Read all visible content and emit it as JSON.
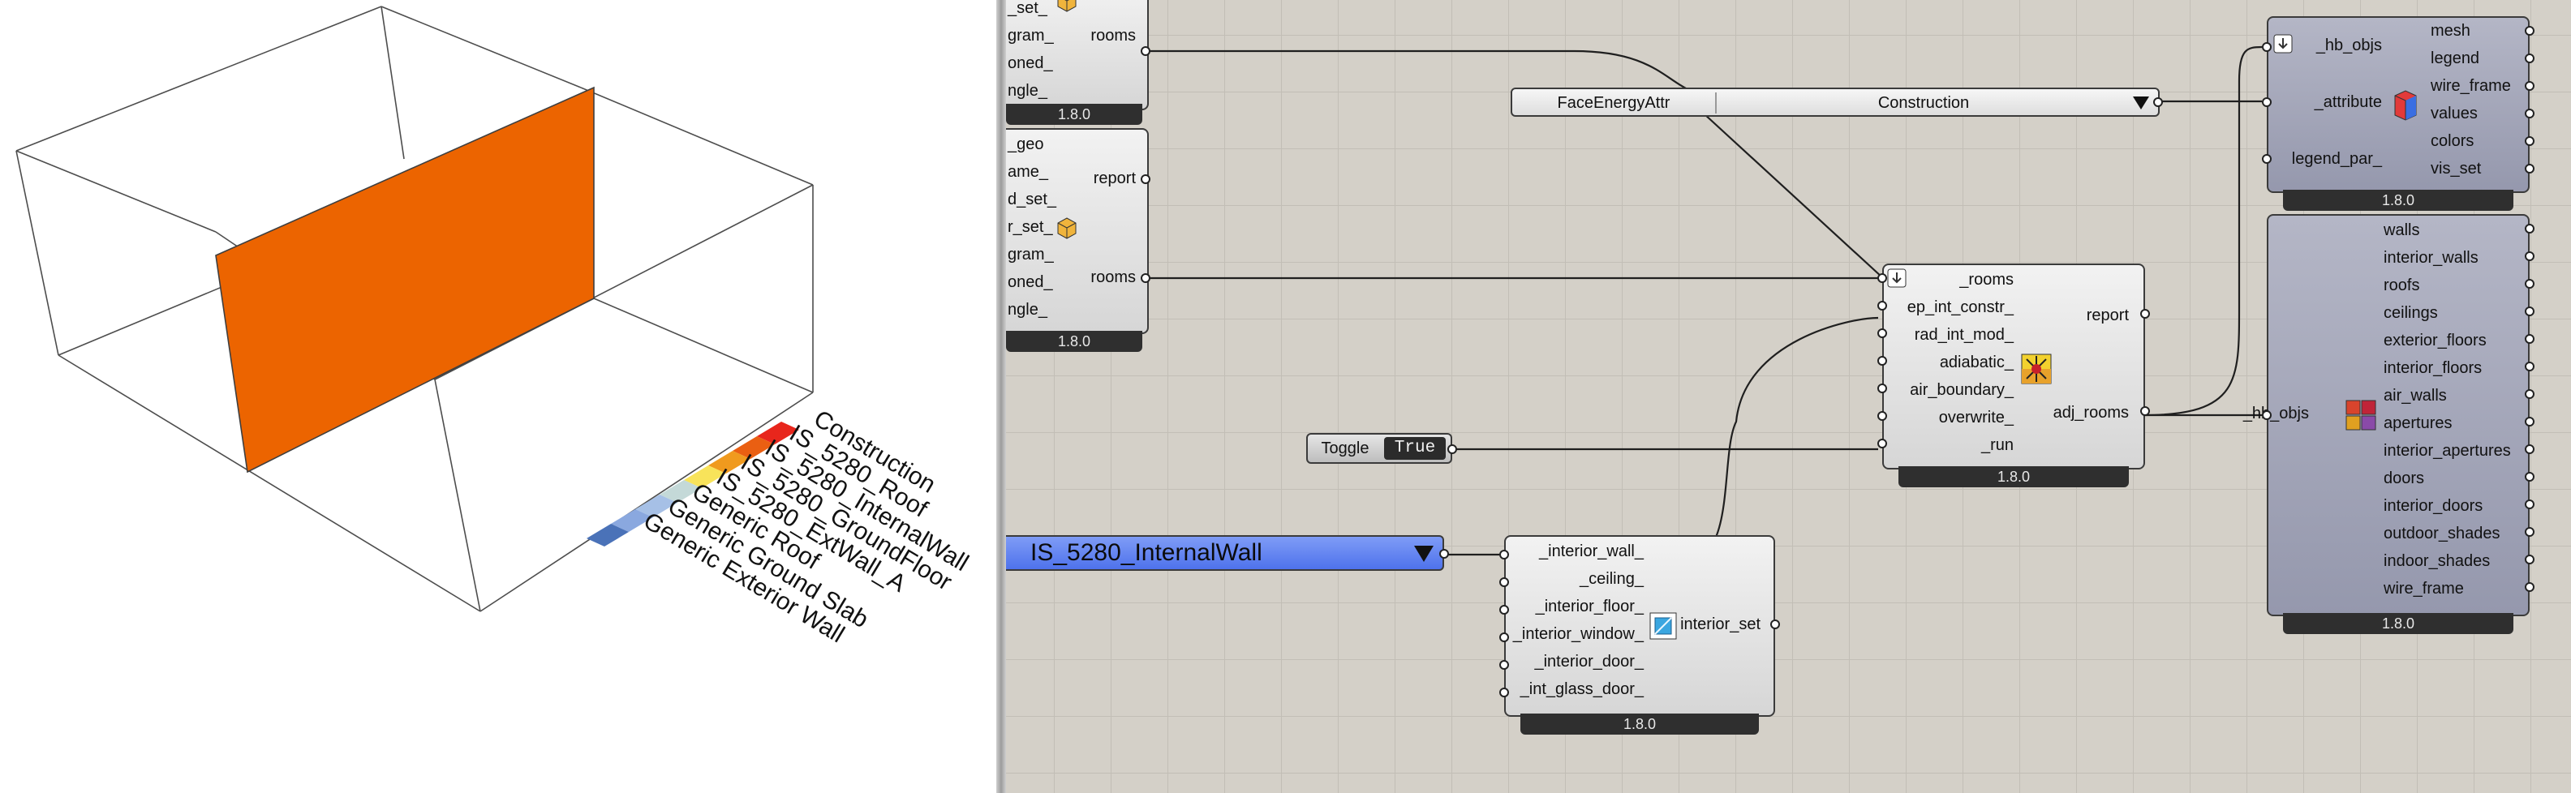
{
  "legend": {
    "items": [
      "Construction",
      "IS_5280_Roof",
      "IS_5280_InternalWall",
      "IS_5280_GroundFloor",
      "IS_5280_ExtWall_A",
      "Generic Roof",
      "Generic Ground Slab",
      "Generic Exterior Wall"
    ],
    "colors": [
      "#e8261c",
      "#ea5f12",
      "#f09a1e",
      "#f8e35a",
      "#c4d9d8",
      "#a6c0e6",
      "#8aa8df",
      "#4a72b8"
    ]
  },
  "comp1": {
    "inputs": [
      "_set_",
      "gram_",
      "oned_",
      "ngle_"
    ],
    "output": "rooms",
    "version": "1.8.0"
  },
  "comp2": {
    "inputs": [
      "_geo",
      "ame_",
      "d_set_",
      "r_set_",
      "gram_",
      "oned_",
      "ngle_"
    ],
    "outputs": [
      "report",
      "rooms"
    ],
    "version": "1.8.0"
  },
  "value_list_attr": {
    "left": "FaceEnergyAttr",
    "right": "Construction"
  },
  "solve_adj": {
    "inputs": [
      "_rooms",
      "ep_int_constr_",
      "rad_int_mod_",
      "adiabatic_",
      "air_boundary_",
      "overwrite_",
      "_run"
    ],
    "outputs": [
      "report",
      "adj_rooms"
    ],
    "version": "1.8.0"
  },
  "toggle": {
    "label": "Toggle",
    "value": "True"
  },
  "value_list_wall": {
    "value": "IS_5280_InternalWall"
  },
  "interior_set": {
    "inputs": [
      "_interior_wall_",
      "_ceiling_",
      "_interior_floor_",
      "_interior_window_",
      "_interior_door_",
      "_int_glass_door_"
    ],
    "output": "interior_set",
    "version": "1.8.0"
  },
  "color_attr": {
    "inputs": [
      "_hb_objs",
      "_attribute",
      "legend_par_"
    ],
    "outputs": [
      "mesh",
      "legend",
      "wire_frame",
      "values",
      "colors",
      "vis_set"
    ],
    "version": "1.8.0"
  },
  "deconstruct": {
    "input": "_hb_objs",
    "outputs": [
      "walls",
      "interior_walls",
      "roofs",
      "ceilings",
      "exterior_floors",
      "interior_floors",
      "air_walls",
      "apertures",
      "interior_apertures",
      "doors",
      "interior_doors",
      "outdoor_shades",
      "indoor_shades",
      "wire_frame"
    ],
    "version": "1.8.0"
  },
  "colors": {
    "wall_face": "#ec6400",
    "value_list_blue": "#5b7ef0",
    "canvas": "#d4d0c8",
    "component": "#e6e6e6"
  }
}
